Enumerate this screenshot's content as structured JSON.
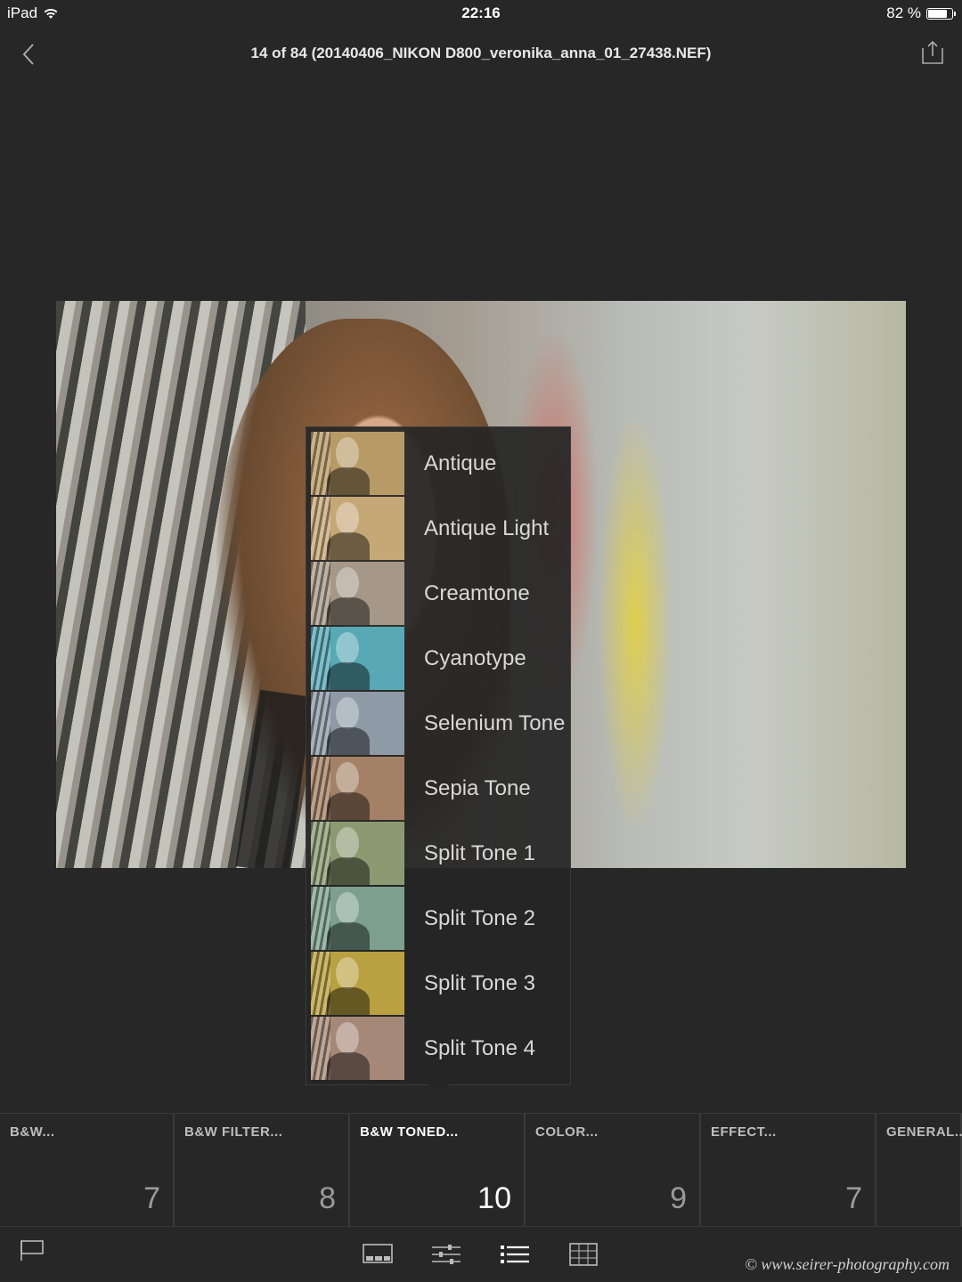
{
  "status": {
    "device": "iPad",
    "time": "22:16",
    "battery": "82 %",
    "battery_level": 0.82
  },
  "nav": {
    "title": "14 of 84 (20140406_NIKON D800_veronika_anna_01_27438.NEF)"
  },
  "presets": [
    {
      "label": "Antique",
      "tint": "#b79a66"
    },
    {
      "label": "Antique Light",
      "tint": "#c6a877"
    },
    {
      "label": "Creamtone",
      "tint": "#a59888"
    },
    {
      "label": "Cyanotype",
      "tint": "#58a8b6"
    },
    {
      "label": "Selenium Tone",
      "tint": "#8e9aa6"
    },
    {
      "label": "Sepia Tone",
      "tint": "#a48166"
    },
    {
      "label": "Split Tone 1",
      "tint": "#8c9a72"
    },
    {
      "label": "Split Tone 2",
      "tint": "#7da08e"
    },
    {
      "label": "Split Tone 3",
      "tint": "#b9a040"
    },
    {
      "label": "Split Tone 4",
      "tint": "#a68878"
    }
  ],
  "categories": [
    {
      "name": "B&W...",
      "count": "7",
      "active": false
    },
    {
      "name": "B&W FILTER...",
      "count": "8",
      "active": false
    },
    {
      "name": "B&W TONED...",
      "count": "10",
      "active": true
    },
    {
      "name": "COLOR...",
      "count": "9",
      "active": false
    },
    {
      "name": "EFFECT...",
      "count": "7",
      "active": false
    },
    {
      "name": "GENERAL...",
      "count": "",
      "active": false
    }
  ],
  "watermark": "© www.seirer-photography.com"
}
